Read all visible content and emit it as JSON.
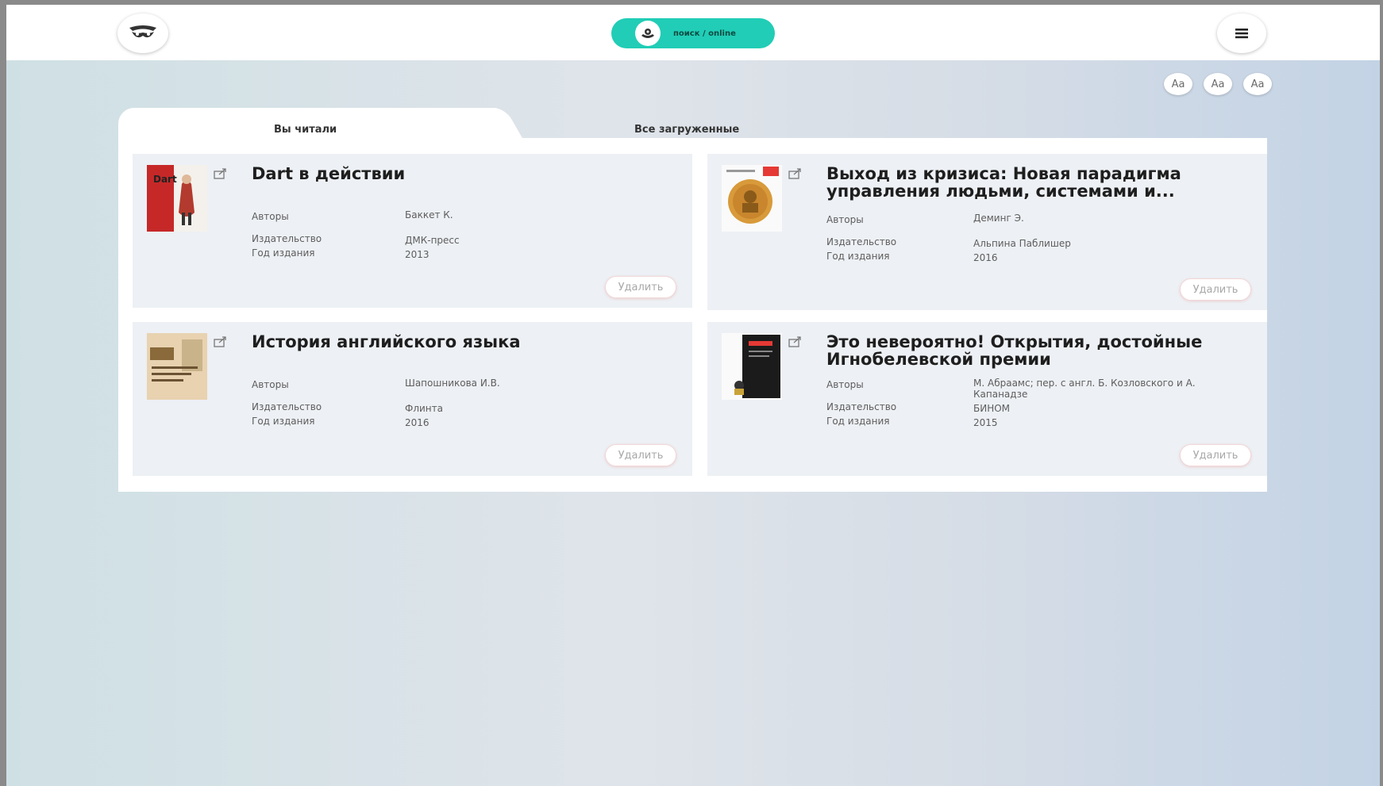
{
  "header": {
    "search_button_label": "поиск / online"
  },
  "font_controls": [
    "Aa",
    "Aa",
    "Aa"
  ],
  "tabs": [
    {
      "label": "Вы читали",
      "active": true
    },
    {
      "label": "Все загруженные",
      "active": false
    }
  ],
  "field_labels": {
    "authors": "Авторы",
    "publisher": "Издательство",
    "year": "Год издания"
  },
  "delete_label": "Удалить",
  "books": [
    {
      "title": "Dart в действии",
      "authors": "Баккет К.",
      "publisher": "ДМК-пресс",
      "year": "2013",
      "cover_text": "Dart"
    },
    {
      "title": "Выход из кризиса: Новая парадигма управления людьми, системами и...",
      "authors": "Деминг Э.",
      "publisher": "Альпина Паблишер",
      "year": "2016"
    },
    {
      "title": "История английского языка",
      "authors": "Шапошникова И.В.",
      "publisher": "Флинта",
      "year": "2016"
    },
    {
      "title": "Это невероятно! Открытия, достойные Игнобелевской премии",
      "authors": "М. Абраамс; пер. с англ. Б. Козловского и А. Капанадзе",
      "publisher": "БИНОМ",
      "year": "2015"
    }
  ],
  "colors": {
    "accent": "#21cdb6",
    "card_bg": "#edf0f4",
    "panel_bg": "#ffffff"
  }
}
